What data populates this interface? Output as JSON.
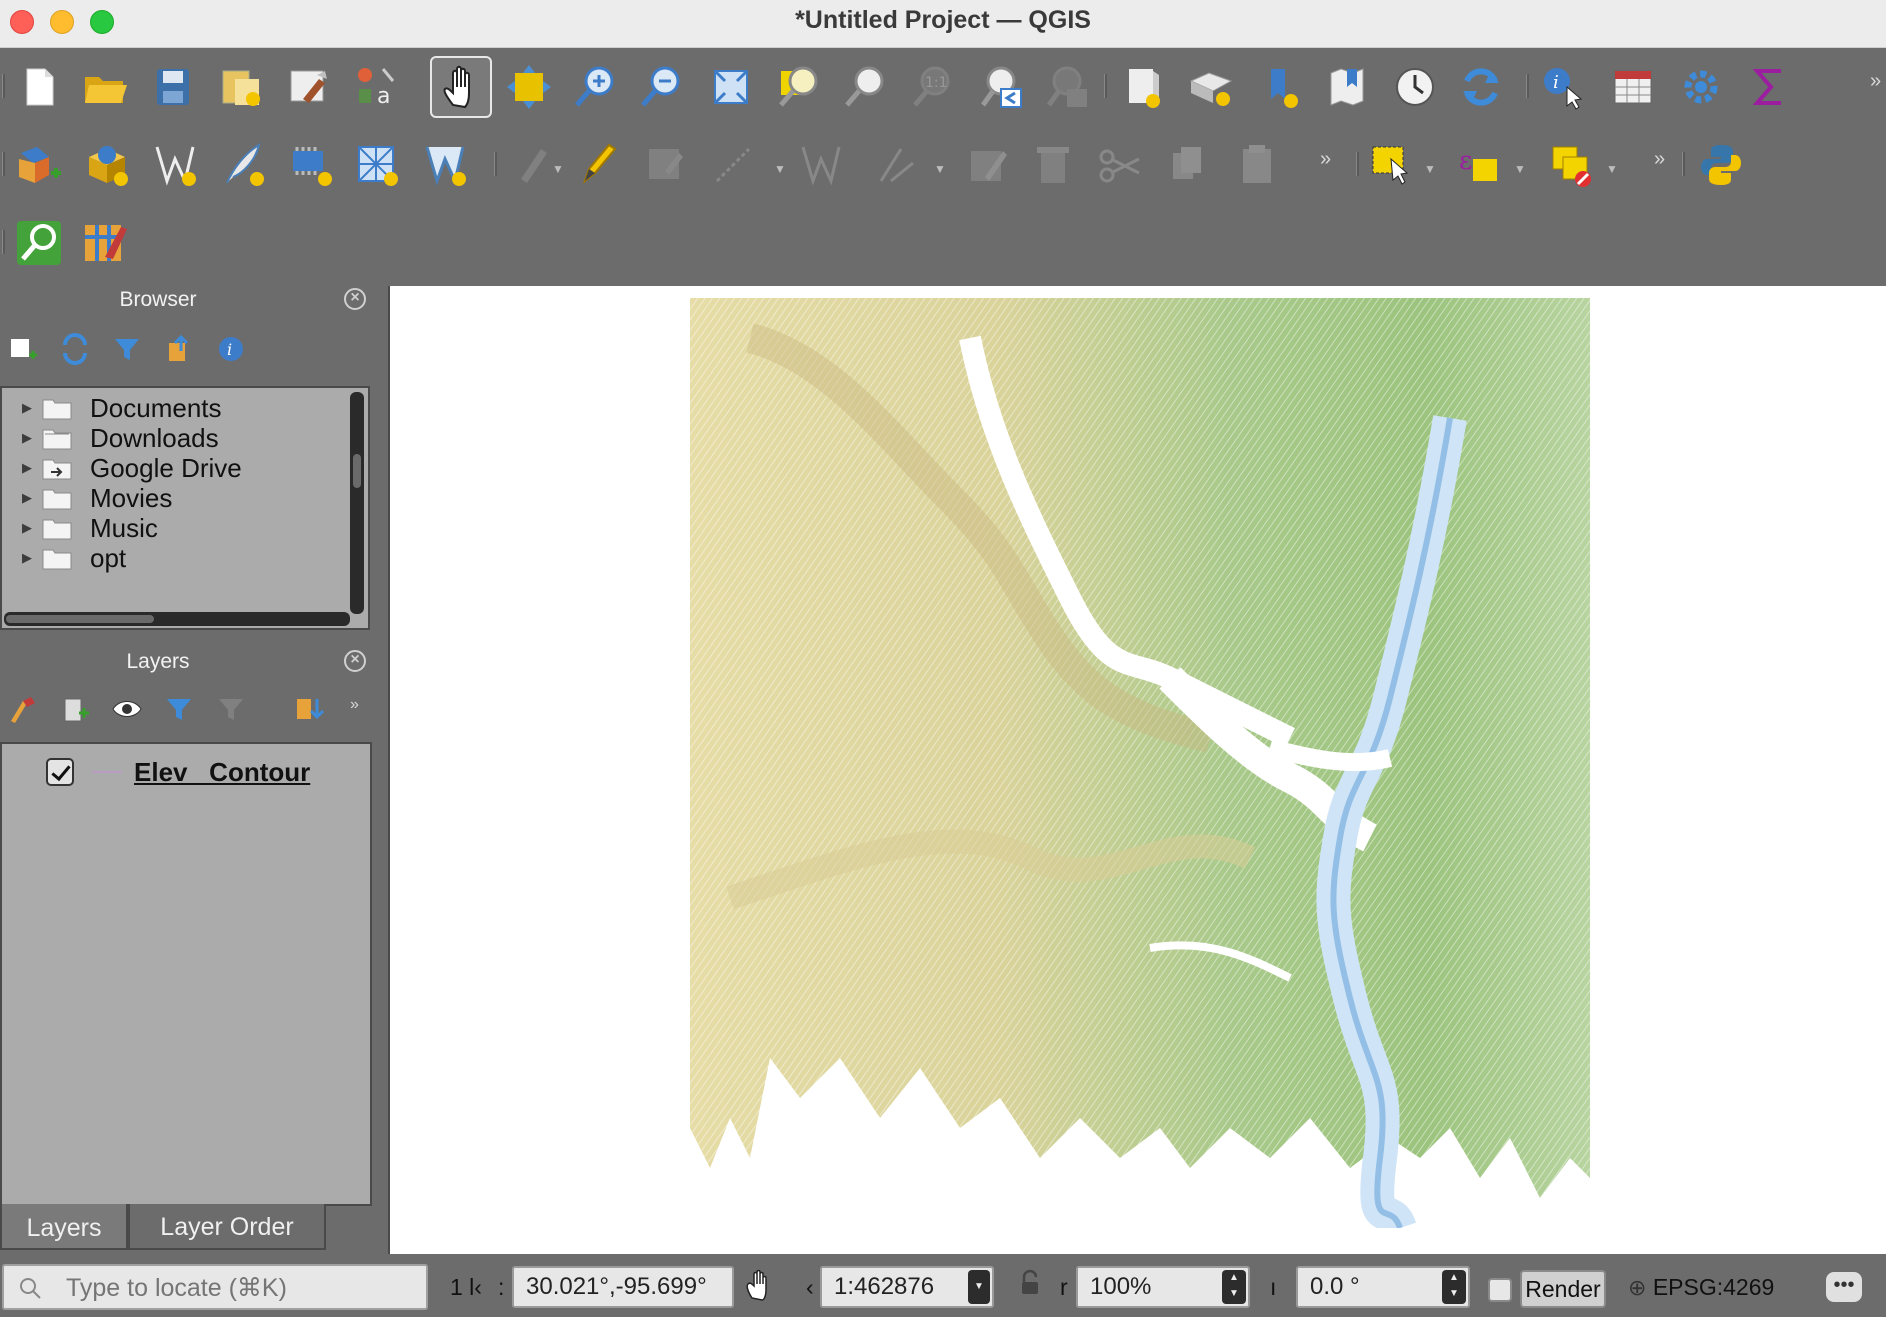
{
  "window": {
    "title": "*Untitled Project — QGIS"
  },
  "toolbar_icons": {
    "row1": [
      "new-project",
      "open-project",
      "save-project",
      "new-print-layout",
      "style-manager",
      "layer-labeling",
      "pan",
      "pan-to-selection",
      "zoom-in",
      "zoom-out",
      "zoom-full",
      "zoom-to-selection",
      "zoom-to-layer",
      "zoom-native",
      "zoom-last",
      "zoom-next",
      "new-spatial-bookmark",
      "show-bookmarks",
      "new-map-view",
      "new-3d-map-view",
      "temporal-controller",
      "refresh",
      "identify-features",
      "open-attribute-table",
      "processing-toolbox",
      "statistical-summary"
    ],
    "row2": [
      "data-source-manager",
      "new-geopackage-layer",
      "new-shapefile-layer",
      "new-temporary-scratch-layer",
      "new-virtual-layer",
      "new-mesh-layer",
      "vertex-tool",
      "current-edits",
      "toggle-editing",
      "save-layer-edits",
      "digitize",
      "vertex-tool-disabled",
      "modify-attributes",
      "delete-selected",
      "cut-features",
      "copy-features",
      "paste-features",
      "select-features",
      "select-by-expression",
      "deselect-all",
      "python-console"
    ],
    "row3": [
      "locator-search",
      "styling-panel"
    ]
  },
  "browser": {
    "title": "Browser",
    "items": [
      {
        "label": "Documents",
        "icon": "folder-icon"
      },
      {
        "label": "Downloads",
        "icon": "folder-icon"
      },
      {
        "label": "Google Drive",
        "icon": "folder-link-icon"
      },
      {
        "label": "Movies",
        "icon": "folder-icon"
      },
      {
        "label": "Music",
        "icon": "folder-icon"
      },
      {
        "label": "opt",
        "icon": "folder-icon"
      }
    ]
  },
  "layers": {
    "title": "Layers",
    "items": [
      {
        "name": "Elev_ Contour",
        "checked": true,
        "symbol_color": "#b89cc2"
      }
    ]
  },
  "left_tabs": {
    "layers": "Layers",
    "layer_order": "Layer Order"
  },
  "status": {
    "locate_placeholder": "Type to locate (⌘K)",
    "legend_label": "1 l‹",
    "coordinate_prefix": ":",
    "coordinate": "30.021°,-95.699°",
    "scale_prefix": "‹",
    "scale": "1:462876",
    "magnifier_prefix": "r",
    "magnifier": "100%",
    "rotation_prefix": "ı",
    "rotation": "0.0 °",
    "render_label": "Render",
    "render_checked": false,
    "crs": "EPSG:4269"
  },
  "colors": {
    "toolbar_bg": "#6c6c6c",
    "panel_bg": "#ababab",
    "map_low": "#a8cbe8",
    "map_mid": "#8fc47a",
    "map_high": "#e4d9a6"
  }
}
